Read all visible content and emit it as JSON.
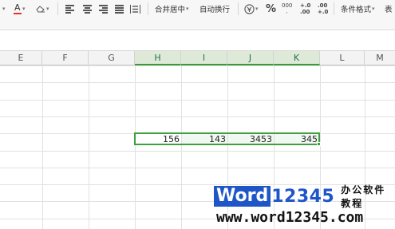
{
  "ribbon": {
    "merge_label": "合井居中",
    "wrap_label": "自动换行",
    "percent_symbol": "%",
    "thousands_label": "000",
    "inc_decimal_top": "+.0",
    "inc_decimal_bottom": ".00",
    "dec_decimal_top": ".00",
    "dec_decimal_bottom": "+.0",
    "cond_format_label": "条件格式",
    "truncated_label": "表",
    "font_color_glyph": "A",
    "accent_red": "#e8312a",
    "accent_green": "#3f9e3f"
  },
  "columns": [
    "E",
    "F",
    "G",
    "H",
    "I",
    "J",
    "K",
    "L",
    "M"
  ],
  "selected_range": [
    "H",
    "I",
    "J",
    "K"
  ],
  "cells": [
    {
      "col": "H",
      "value": "156"
    },
    {
      "col": "I",
      "value": "143"
    },
    {
      "col": "J",
      "value": "3453"
    },
    {
      "col": "K",
      "value": "345"
    }
  ],
  "watermark": {
    "brand_boxed": "Word",
    "brand_rest": "12345",
    "tagline": "办公软件教程",
    "url": "www.word12345.com"
  }
}
